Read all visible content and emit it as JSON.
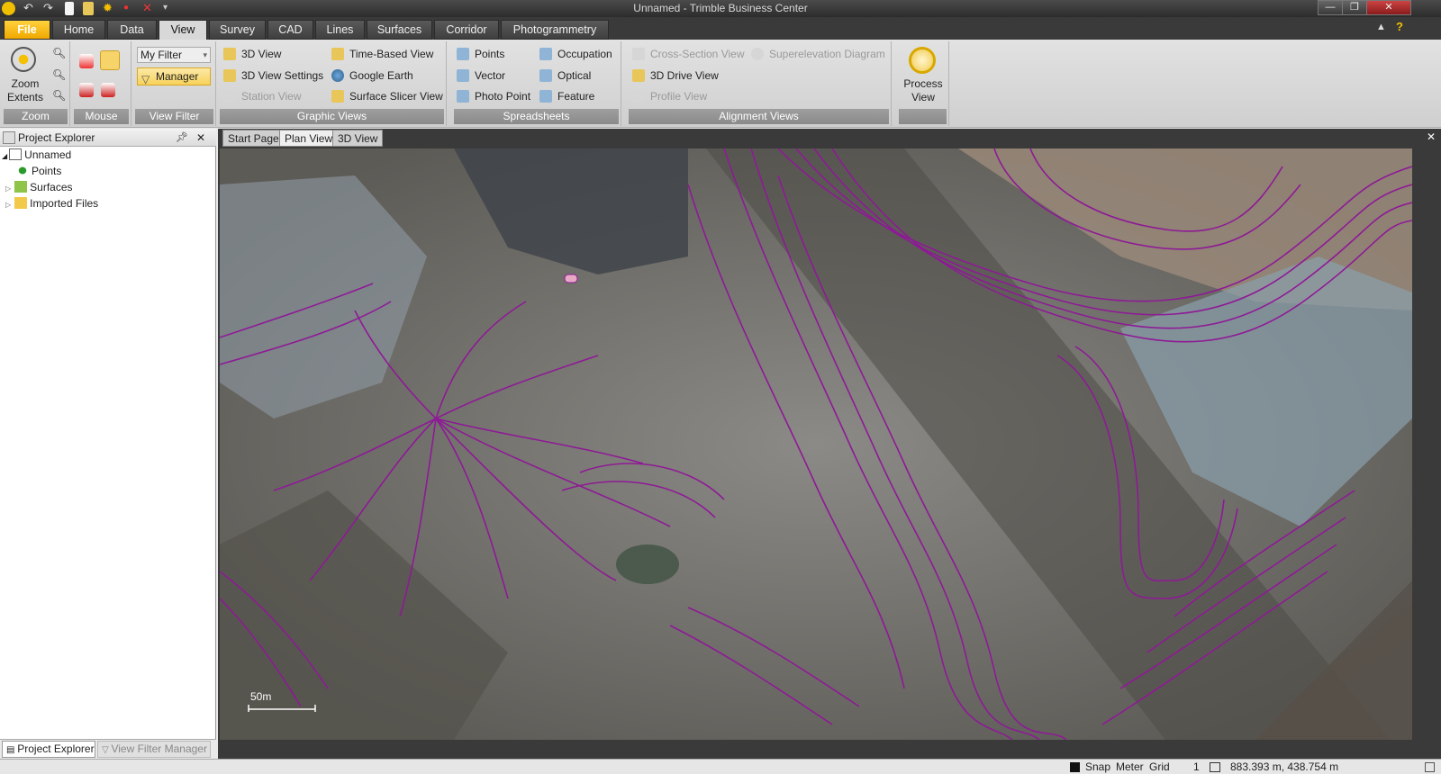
{
  "window": {
    "title": "Unnamed - Trimble Business Center"
  },
  "tabs": [
    {
      "label": "File"
    },
    {
      "label": "Home"
    },
    {
      "label": "Data"
    },
    {
      "label": "View"
    },
    {
      "label": "Survey"
    },
    {
      "label": "CAD"
    },
    {
      "label": "Lines"
    },
    {
      "label": "Surfaces"
    },
    {
      "label": "Corridor"
    },
    {
      "label": "Photogrammetry"
    }
  ],
  "ribbon": {
    "zoom": {
      "extents_label": "Zoom Extents",
      "group_label": "Zoom"
    },
    "mouse": {
      "group_label": "Mouse"
    },
    "view_filter": {
      "selected": "My Filter",
      "manager_label": "Manager",
      "group_label": "View Filter"
    },
    "graphic_views": {
      "items": [
        "3D View",
        "3D View Settings",
        "Station View",
        "Time-Based View",
        "Google Earth",
        "Surface Slicer View"
      ],
      "group_label": "Graphic Views"
    },
    "spreadsheets": {
      "items": [
        "Points",
        "Vector",
        "Photo Point",
        "Occupation",
        "Optical",
        "Feature"
      ],
      "group_label": "Spreadsheets"
    },
    "alignment_views": {
      "items": [
        "Cross-Section View",
        "3D Drive View",
        "Profile View",
        "Superelevation Diagram"
      ],
      "group_label": "Alignment Views"
    },
    "process_view": {
      "label": "Process View"
    }
  },
  "explorer": {
    "title": "Project Explorer",
    "tree": [
      {
        "label": "Unnamed"
      },
      {
        "label": "Points"
      },
      {
        "label": "Surfaces"
      },
      {
        "label": "Imported Files"
      }
    ],
    "bottom_tabs": [
      "Project Explorer",
      "View Filter Manager"
    ]
  },
  "doc_tabs": [
    "Start Page",
    "Plan View",
    "3D View"
  ],
  "map": {
    "scale_label": "50m"
  },
  "status": {
    "snap": "Snap",
    "units": "Meter",
    "grid": "Grid",
    "zoom_value": "1",
    "coordinates": "883.393 m, 438.754 m"
  }
}
